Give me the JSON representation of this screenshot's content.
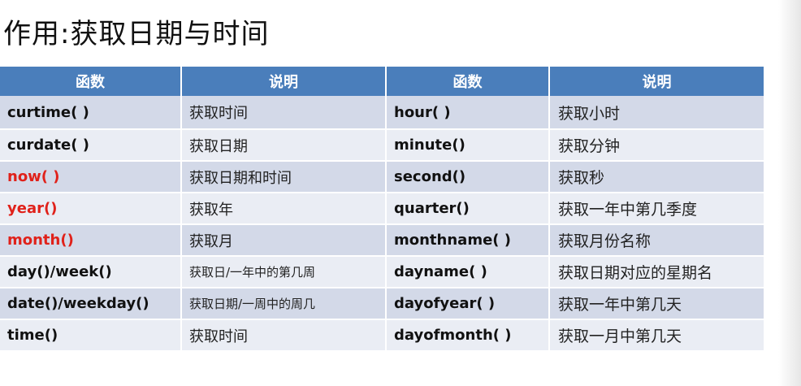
{
  "title": "作用:获取日期与时间",
  "table": {
    "headers": [
      "函数",
      "说明",
      "函数",
      "说明"
    ],
    "rows": [
      {
        "fn1": "curtime( )",
        "desc1": "获取时间",
        "fn2": "hour( )",
        "desc2": "获取小时"
      },
      {
        "fn1": "curdate( )",
        "desc1": "获取日期",
        "fn2": "minute()",
        "desc2": "获取分钟"
      },
      {
        "fn1": "now( )",
        "desc1": "获取日期和时间",
        "fn2": "second()",
        "desc2": "获取秒"
      },
      {
        "fn1": "year()",
        "desc1": "获取年",
        "fn2": "quarter()",
        "desc2": "获取一年中第几季度"
      },
      {
        "fn1": "month()",
        "desc1": "获取月",
        "fn2": "monthname( )",
        "desc2": "获取月份名称"
      },
      {
        "fn1": "day()/week()",
        "desc1": "获取日/一年中的第几周",
        "fn2": "dayname( )",
        "desc2": "获取日期对应的星期名"
      },
      {
        "fn1": "date()/weekday()",
        "desc1": "获取日期/一周中的周几",
        "fn2": "dayofyear( )",
        "desc2": "获取一年中第几天"
      },
      {
        "fn1": "time()",
        "desc1": "获取时间",
        "fn2": "dayofmonth( )",
        "desc2": "获取一月中第几天"
      }
    ]
  },
  "colors": {
    "header_bg": "#4a7ebb",
    "row_dark": "#d3d9e8",
    "row_light": "#eaedf4",
    "highlight_text": "#e0211a"
  }
}
